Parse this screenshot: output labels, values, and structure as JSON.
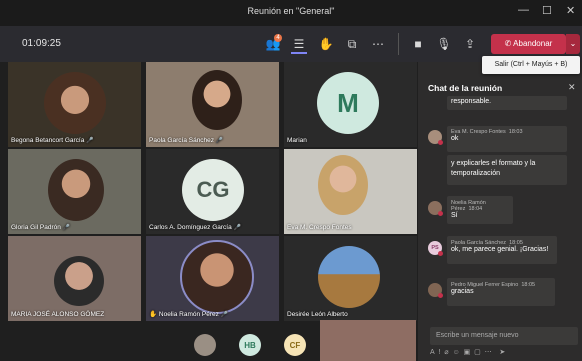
{
  "window": {
    "title": "Reunión en \"General\"",
    "min": "—",
    "max": "☐",
    "close": "✕"
  },
  "toolbar": {
    "timer": "01:09:25",
    "people_badge": "4",
    "leave_label": "Abandonar",
    "tooltip": "Salir (Ctrl + Mayús + B)"
  },
  "participants": [
    {
      "name": "Begona Betancort García"
    },
    {
      "name": "Paola García Sánchez"
    },
    {
      "name": "Marian",
      "initials": "M"
    },
    {
      "name": "Gloria Gil Padrón"
    },
    {
      "name": "Carlos A. Domínguez García",
      "initials": "CG"
    },
    {
      "name": "Eva M. Crespo Fontes"
    },
    {
      "name": "MARIA JOSÉ ALONSO GÓMEZ"
    },
    {
      "name": "Noelia Ramón Pérez"
    },
    {
      "name": "Desirée León Alberto"
    }
  ],
  "bottom_row": [
    {
      "initials": "HB"
    },
    {
      "initials": "CF"
    }
  ],
  "chat": {
    "title": "Chat de la reunión",
    "close": "✕",
    "messages": [
      {
        "text": "responsable."
      },
      {
        "author": "Eva M. Crespo Fontes",
        "time": "18:03",
        "text": "ok"
      },
      {
        "text": "y explicarles el formato y la temporalización"
      },
      {
        "author": "Noelia Ramón Pérez",
        "time": "18:04",
        "text": "Sí"
      },
      {
        "author": "Paola García Sánchez",
        "time": "18:05",
        "text": "ok, me parece genial. ¡Gracias!",
        "initials": "PS"
      },
      {
        "author": "Pedro Miguel Ferrer Espino",
        "time": "18:05",
        "text": "gracias"
      }
    ],
    "input_placeholder": "Escribe un mensaje nuevo"
  },
  "colors": {
    "leave": "#c4314b",
    "chat_bg": "#2d2c2c",
    "bubble": "#3b3a39",
    "toolbar": "#2b2b30"
  }
}
